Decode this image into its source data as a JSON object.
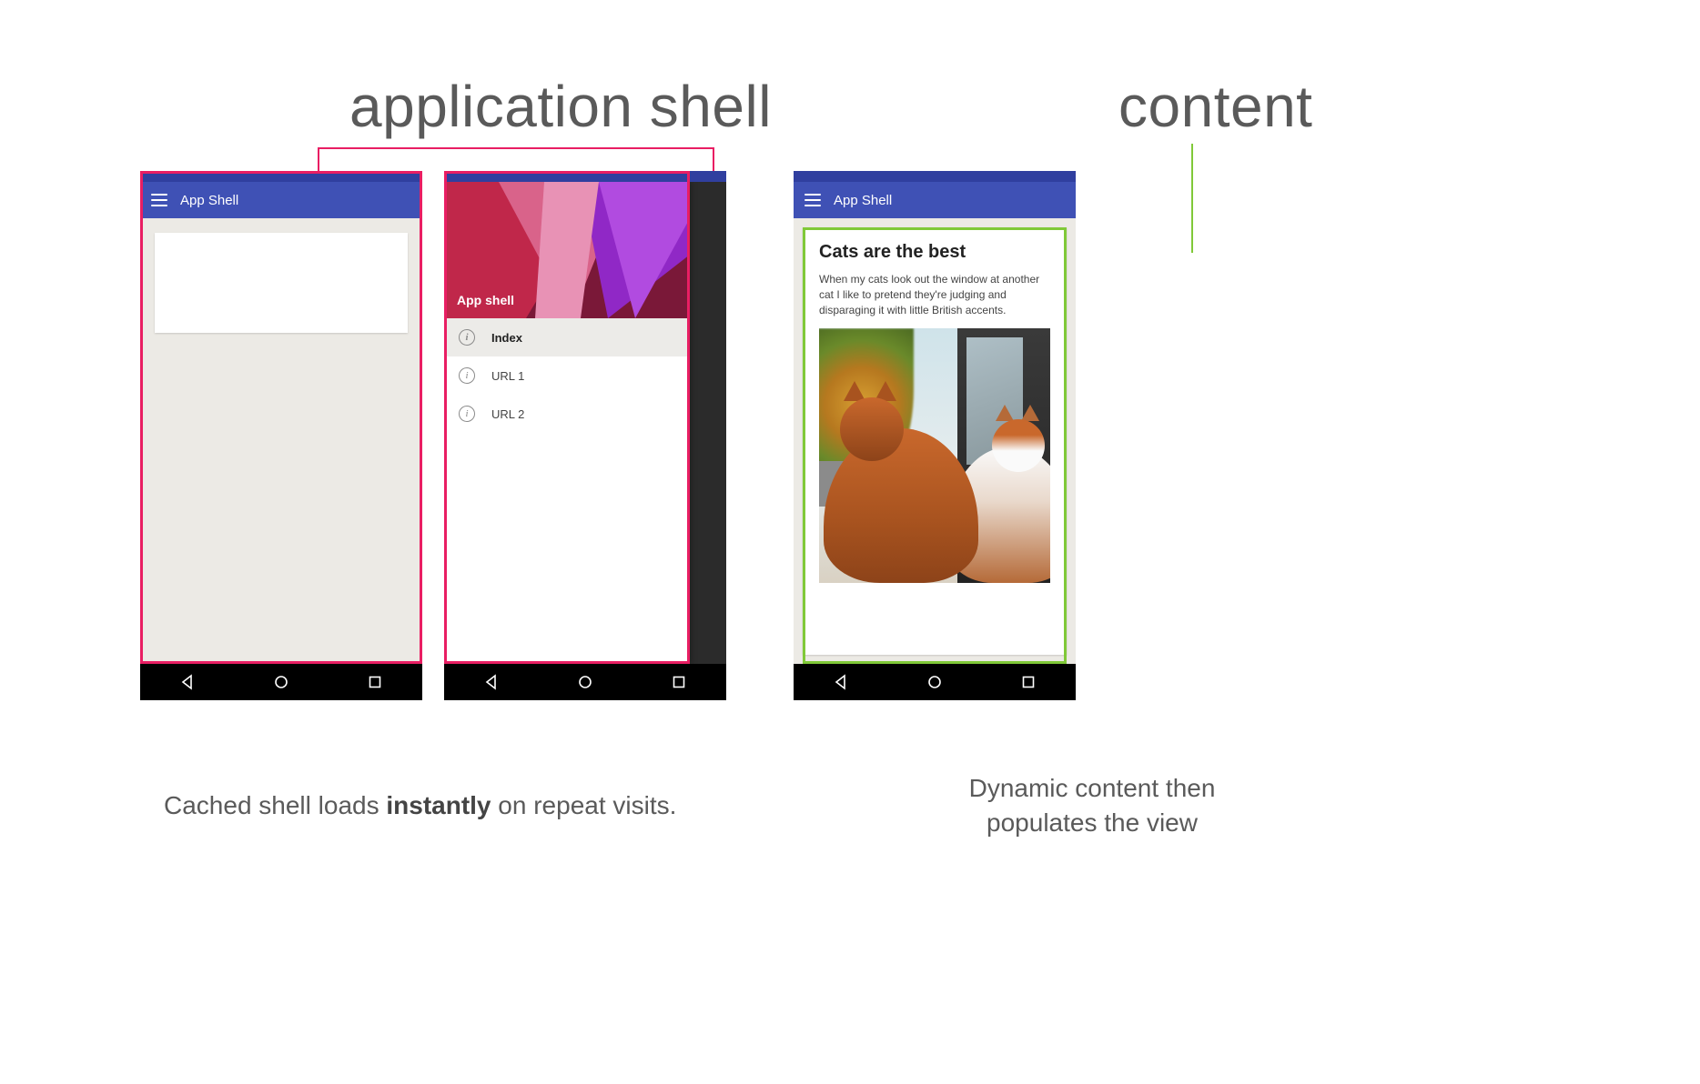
{
  "headings": {
    "shell": "application shell",
    "content": "content"
  },
  "captions": {
    "left_pre": "Cached shell loads ",
    "left_strong": "instantly",
    "left_post": " on repeat visits.",
    "right": "Dynamic content then populates the view"
  },
  "appbar_title": "App Shell",
  "drawer": {
    "title": "App shell",
    "items": [
      {
        "label": "Index",
        "selected": true
      },
      {
        "label": "URL 1",
        "selected": false
      },
      {
        "label": "URL 2",
        "selected": false
      }
    ]
  },
  "content_card": {
    "title": "Cats are the best",
    "body": "When my cats look out the window at another cat I like to pretend they're judging and disparaging it with little British accents."
  },
  "colors": {
    "appbar": "#3f51b5",
    "statusbar": "#303f9f",
    "pink": "#e91e63",
    "green": "#80c938"
  }
}
